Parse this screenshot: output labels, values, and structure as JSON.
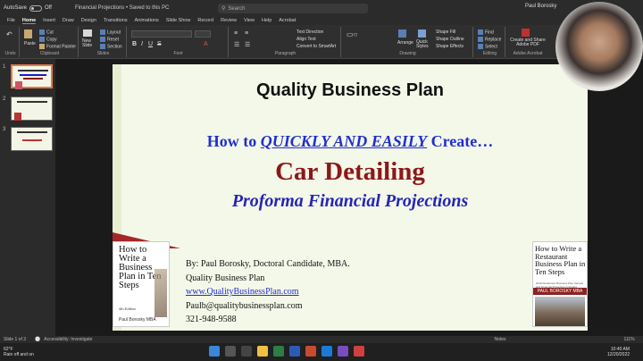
{
  "titlebar": {
    "autosave_label": "AutoSave",
    "autosave_state": "Off",
    "document_title": "Financial Projections • Saved to this PC",
    "search_placeholder": "Search",
    "user_name": "Paul Borosky"
  },
  "menu": {
    "items": [
      "File",
      "Home",
      "Insert",
      "Draw",
      "Design",
      "Transitions",
      "Animations",
      "Slide Show",
      "Record",
      "Review",
      "View",
      "Help",
      "Acrobat"
    ],
    "active": "Home"
  },
  "ribbon": {
    "undo_label": "Undo",
    "clipboard": {
      "label": "Clipboard",
      "paste": "Paste",
      "cut": "Cut",
      "copy": "Copy",
      "format_painter": "Format Painter"
    },
    "slides": {
      "label": "Slides",
      "new_slide": "New Slide",
      "layout": "Layout",
      "reset": "Reset",
      "section": "Section"
    },
    "font": {
      "label": "Font"
    },
    "paragraph": {
      "label": "Paragraph",
      "text_direction": "Text Direction",
      "align_text": "Align Text",
      "convert_smartart": "Convert to SmartArt"
    },
    "drawing": {
      "label": "Drawing",
      "arrange": "Arrange",
      "quick_styles": "Quick Styles",
      "shape_fill": "Shape Fill",
      "shape_outline": "Shape Outline",
      "shape_effects": "Shape Effects"
    },
    "editing": {
      "label": "Editing",
      "find": "Find",
      "replace": "Replace",
      "select": "Select"
    },
    "acrobat": {
      "label": "Adobe Acrobat",
      "create_share": "Create and Share Adobe PDF"
    }
  },
  "sidebar": {
    "slides": [
      {
        "number": "1"
      },
      {
        "number": "2"
      },
      {
        "number": "3"
      }
    ],
    "selected": 1
  },
  "slide": {
    "title": "Quality Business Plan",
    "subtitle_prefix": "How to ",
    "subtitle_emphasis": "QUICKLY AND EASILY",
    "subtitle_suffix": " Create…",
    "topic": "Car Detailing",
    "tagline": "Proforma Financial Projections",
    "contact": {
      "author": "By: Paul Borosky, Doctoral Candidate, MBA.",
      "company": "Quality Business Plan",
      "website": "www.QualityBusinessPlan.com",
      "email": "Paulb@qualitybusinessplan.com",
      "phone": "321-948-9588"
    },
    "book_left": {
      "title": "How to Write a Business Plan in Ten Steps",
      "edition": "4th Edition",
      "author": "Paul Borosky MBA"
    },
    "book_right": {
      "title": "How to Write a Restaurant Business Plan in Ten Steps",
      "subtitle": "2019 Restaurant Business Plan Sample and Financial Projections Included",
      "author": "PAUL BOROSKY MBA"
    }
  },
  "statusbar": {
    "slide_position": "Slide 1 of 3",
    "accessibility": "Accessibility: Investigate",
    "notes": "Notes",
    "zoom": "111%"
  },
  "taskbar": {
    "temperature": "62°F",
    "weather": "Rain off and on",
    "time": "10:40 AM",
    "date": "12/20/2022"
  },
  "colors": {
    "accent": "#e07a4a",
    "slide_background": "#f4f8e8",
    "title_blue": "#1f2fd1",
    "topic_red": "#8b1818"
  }
}
